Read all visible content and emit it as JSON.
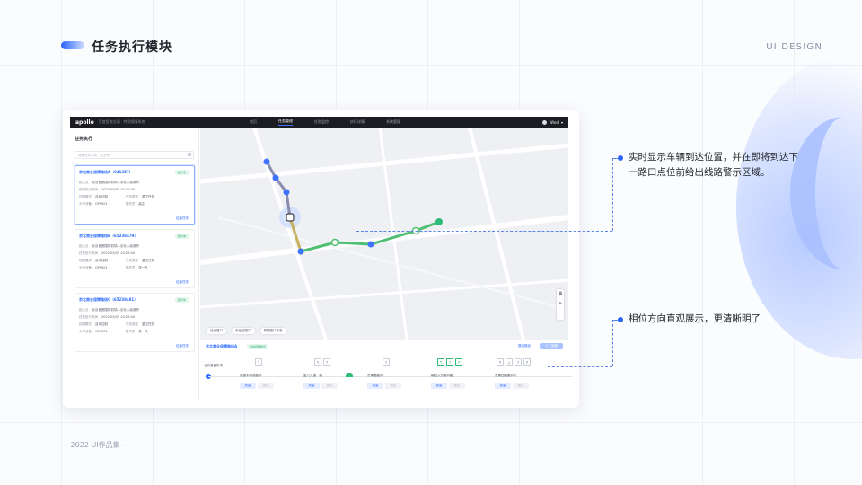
{
  "page": {
    "title": "任务执行模块",
    "ui_design": "UI  DESIGN",
    "footer": "— 2022 UI作品集 —"
  },
  "app": {
    "logo": "apollo",
    "subtitle": "百度智能交通 · 特勤保障系统",
    "nav": [
      "首页",
      "任务管理",
      "任务监控",
      "执行详情",
      "系统管理"
    ],
    "active_nav": "任务管理",
    "user": "Wind"
  },
  "left_panel": {
    "title": "任务执行",
    "search_placeholder": "搜索任务名称、任务号",
    "tasks": [
      {
        "name": "京北商业保障路线A（941357）",
        "badge": "执行中",
        "rows": [
          {
            "k": "起止点",
            "v": "北京首都国际机场—京北人民政府"
          },
          {
            "k": "任务执行时间",
            "v": "2022/05/05 10:20:00"
          },
          {
            "k": "控制模式",
            "v": "自动控制",
            "k2": "任务类型",
            "v2": "重卫任务"
          },
          {
            "k": "头车设备",
            "v": "GPS001",
            "k2": "操作员",
            "v2": "高正"
          }
        ],
        "link": "结束任务"
      },
      {
        "name": "京北商业保障路线B（65238479）",
        "badge": "执行中",
        "rows": [
          {
            "k": "起止点",
            "v": "北京首都国际机场—京北人民政府"
          },
          {
            "k": "任务执行时间",
            "v": "2022/05/05 10:20:00"
          },
          {
            "k": "控制模式",
            "v": "自动控制",
            "k2": "任务类型",
            "v2": "重卫任务"
          },
          {
            "k": "头车设备",
            "v": "GPS001",
            "k2": "操作员",
            "v2": "张一凡"
          }
        ],
        "link": "结束任务"
      },
      {
        "name": "京北商业保障路线C（65238481）",
        "badge": "执行中",
        "rows": [
          {
            "k": "起止点",
            "v": "北京首都国际机场—京北人民政府"
          },
          {
            "k": "任务执行时间",
            "v": "2022/05/05 10:20:00"
          },
          {
            "k": "控制模式",
            "v": "自动控制",
            "k2": "任务类型",
            "v2": "重卫任务"
          },
          {
            "k": "头车设备",
            "v": "GPS001",
            "k2": "操作员",
            "v2": "张一凡"
          }
        ],
        "link": "结束任务"
      }
    ]
  },
  "map": {
    "legend": [
      "已经路口",
      "未经过路口",
      "离线路口状态"
    ],
    "zoom_in": "+",
    "zoom_out": "−"
  },
  "bottom": {
    "title": "京北商业保障路线A",
    "badge": "自动控制模式",
    "link": "路线路径",
    "button": "人工接管",
    "start": "北京首都机场",
    "nodes": [
      {
        "name": "京都车局前路口",
        "icons": [
          "↑"
        ],
        "on": false
      },
      {
        "name": "复兴大道一路",
        "icons": [
          "↰",
          "↑"
        ],
        "on": false
      },
      {
        "name": "东湖路路口",
        "icons": [
          "↑"
        ],
        "on": false
      },
      {
        "name": "朝阳大东路口路",
        "icons": [
          "↰",
          "↑",
          "↱"
        ],
        "on": true
      },
      {
        "name": "东湖四路路口东",
        "icons": [
          "↰",
          "↓",
          "↑",
          "↱"
        ],
        "on": false
      }
    ],
    "node_btn_a": "放量",
    "node_btn_b": "锁定"
  },
  "callouts": {
    "first": "实时显示车辆到达位置，并在即将到达下一路口点位前给出线路警示区域。",
    "first_line1": "实时显示车辆到达位置，并在即将到达下",
    "first_line2": "一路口点位前给出线路警示区域。",
    "second": "相位方向直观展示，更清晰明了"
  },
  "colors": {
    "accent": "#2a64ff",
    "green": "#2dbb78",
    "dark_bar": "#1c1d22"
  }
}
